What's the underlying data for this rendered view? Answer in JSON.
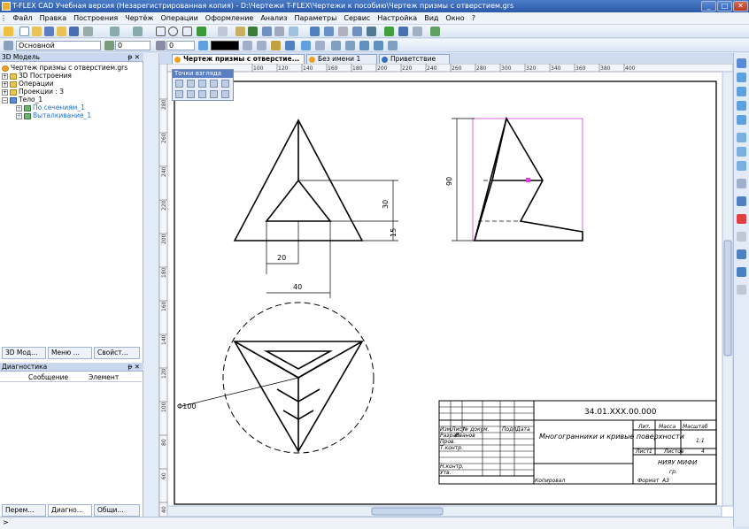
{
  "window": {
    "title": "T-FLEX CAD Учебная версия (Незарегистрированная копия) - D:\\Чертежи T-FLEX\\Чертежи к пособию\\Чертеж призмы с отверстием.grs",
    "min": "_",
    "max": "□",
    "close": "✕"
  },
  "menu": [
    "Файл",
    "Правка",
    "Построения",
    "Чертёж",
    "Операции",
    "Оформление",
    "Анализ",
    "Параметры",
    "Сервис",
    "Настройка",
    "Вид",
    "Окно",
    "?"
  ],
  "toolbar2": {
    "layer": "Основной",
    "num1": "0",
    "num2": "0"
  },
  "left": {
    "header": "3D Модель",
    "pin": "ᵽ ✕",
    "tree": [
      "Чертеж призмы с отверстием.grs",
      "3D Построения",
      "Операции",
      "Проекции : 3",
      "Тело_1",
      "По сечениям_1",
      "Выталкивание_1"
    ],
    "tabs": [
      "3D Мод...",
      "Меню ...",
      "Свойст..."
    ],
    "diag_header": "Диагностика",
    "diag_cols": [
      "Сообщение",
      "Элемент"
    ],
    "bottom_tabs": [
      "Перем...",
      "Диагно...",
      "Общи..."
    ]
  },
  "doc_tabs": [
    "Чертеж призмы с отверстие...",
    "Без имени 1",
    "Приветствие"
  ],
  "viewpoints": "Точки взгляда",
  "ruler_top": [
    "100",
    "120",
    "140",
    "160",
    "180",
    "200",
    "220",
    "240",
    "260",
    "280",
    "300",
    "320",
    "340",
    "360",
    "380",
    "400"
  ],
  "ruler_left": [
    "280",
    "260",
    "240",
    "220",
    "200",
    "180",
    "160",
    "140",
    "120",
    "100",
    "80",
    "60",
    "40"
  ],
  "drawing": {
    "dim30": "30",
    "dim15": "15",
    "dim20": "20",
    "dim40": "40",
    "dim90": "90",
    "diam": "Φ100"
  },
  "stamp": {
    "code": "34.01.XXX.00.000",
    "name": "Многогранники и кривые поверхности",
    "lit": "Лит.",
    "mass": "Масса",
    "scale": "Масштаб",
    "scale_val": "1:1",
    "sheet": "Лист",
    "sheet_val": "1",
    "sheets": "Листов",
    "sheets_val": "4",
    "org": "НИЯУ МИФИ",
    "group": "гр.",
    "rows": [
      "Изм.",
      "Лист",
      "№ докум.",
      "Подп.",
      "Дата"
    ],
    "roles": [
      "Разраб.",
      "Пров.",
      "Т.контр.",
      "Н.контр.",
      "Утв."
    ],
    "dev": "Иванов",
    "copied": "Копировал",
    "format": "Формат",
    "format_val": "А3"
  },
  "status": ">"
}
